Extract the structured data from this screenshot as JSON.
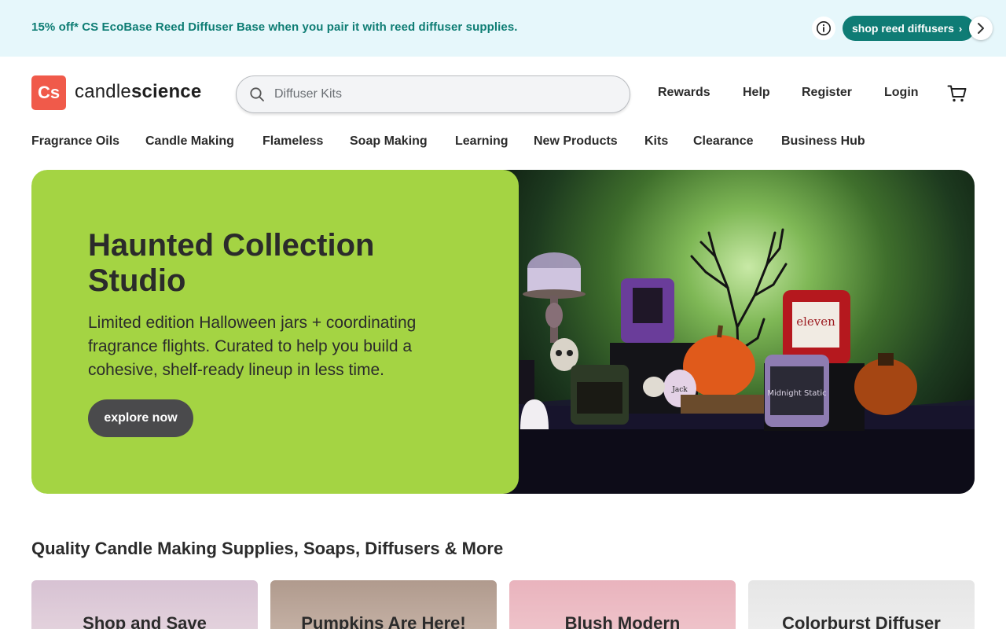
{
  "promo": {
    "text": "15% off* CS EcoBase Reed Diffuser Base when you pair it with reed diffuser supplies.",
    "cta_label": "shop reed diffusers",
    "cta_chevron": "›"
  },
  "header": {
    "logo_mark": "Cs",
    "logo_word_light": "candle",
    "logo_word_bold": "science",
    "search_placeholder": "Diffuser Kits",
    "links": [
      "Rewards",
      "Help",
      "Register",
      "Login"
    ]
  },
  "nav": {
    "items": [
      "Fragrance Oils",
      "Candle Making",
      "Flameless",
      "Soap Making",
      "Learning",
      "New Products",
      "Kits",
      "Clearance",
      "Business Hub"
    ]
  },
  "hero": {
    "title": "Haunted Collection Studio",
    "subtitle": "Limited edition Halloween jars + coordinating fragrance flights. Curated to help you build a cohesive, shelf-ready lineup in less time.",
    "button_label": "explore now",
    "jar_labels": [
      "eleven",
      "Midnight Static",
      "Jack"
    ]
  },
  "section": {
    "title": "Quality Candle Making Supplies, Soaps, Diffusers & More",
    "cards": [
      "Shop and Save",
      "Pumpkins Are Here!",
      "Blush Modern",
      "Colorburst Diffuser"
    ]
  },
  "colors": {
    "brand": "#f05a4a",
    "teal": "#0f7c75",
    "hero_green": "#a4d443",
    "promo_bg": "#e6f7fb"
  }
}
